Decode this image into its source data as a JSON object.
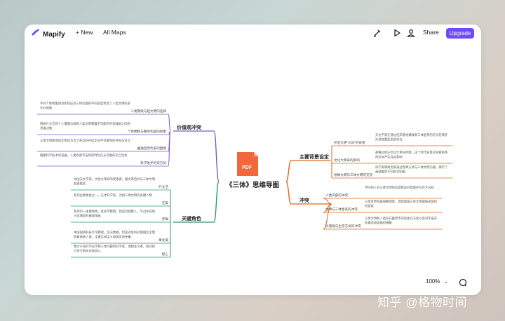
{
  "app": {
    "name": "Mapify",
    "new_label": "New",
    "all_maps_label": "All Maps",
    "share_label": "Share",
    "upgrade_label": "Upgrade",
    "zoom": "100%",
    "watermark": "知乎 @格物时间"
  },
  "icons": {
    "logo": "mapify-logo-icon",
    "plus": "plus-icon",
    "brush": "brush-icon",
    "play": "play-icon",
    "user": "user-icon",
    "zoom_dropdown": "chevron-down-icon",
    "chat": "chat-icon",
    "pdf": "pdf-file-icon"
  },
  "colors": {
    "accent": "#6d4aff",
    "branch_values": "#7a5ac8",
    "branch_characters": "#2e9a64",
    "branch_themes": "#e0661f",
    "branch_conflict": "#e0661f",
    "pdf": "#f2683d"
  },
  "mindmap": {
    "root": "《三体》思维导图",
    "pdf_label": "PDF",
    "values": {
      "label": "价值观冲突",
      "items": [
        {
          "label": "人类救赎与超文明的选择",
          "note": "不同个体和集团对如何应对三体问题的不同态度体现了人类文明的多元价值观"
        },
        {
          "label": "个体牺牲与整体利益的权衡",
          "note": "例如叶文洁的个人遭遇与她将人类文明暴露于可能的外星威胁之间的矛盾决策"
        },
        {
          "label": "幽独自然代表的困境",
          "note": "三体文明和地球文明双方为了各自的存续走向不可避免的冲突与对立"
        },
        {
          "label": "科学进步的双刃剑",
          "note": "随着科学技术的发展，人类探索宇宙的同时也在未可能的灭亡危机"
        }
      ]
    },
    "characters": {
      "label": "关键角色",
      "items": [
        {
          "label": "叶文洁",
          "note": "中国天文学家，文化大革命的受害者。跟文革后并与三体文明取得联系"
        },
        {
          "label": "汪淼",
          "note": "系列主要角色之一，天才科学家，对抗三体文明的关键人物"
        },
        {
          "label": "罗辑",
          "note": "系列另一主要角色，社会学教授，后成为面壁人，学过多名和三体博弈的重要角色"
        },
        {
          "label": "章北海",
          "note": "中国国防科技大学教授，坚决勇敢，但是对危机对策相信无需依靠拯救人类，注重实用主义和现实的考量"
        },
        {
          "label": "程心",
          "note": "致力于研究宇宙学和三体问题的科学家，理想主义者，和对抗三体文明无奈和态心"
        }
      ]
    },
    "themes": {
      "label": "主要背景设定",
      "items": [
        {
          "label": "外星文明\"三体\"的背景",
          "note": "天文学家在通过红岸基地偶收到三体星系的信号后揭开外星智慧生命的存在"
        },
        {
          "label": "文化大革命的影响",
          "note": "故事起始于文化大革命时期，这个时代背景对主要角色的命运产生深远影响"
        },
        {
          "label": "地球文明与三体文明的交流",
          "note": "科学家和政治家通过各种方式与三体文明沟通，揭示了两种截然不同的文明观"
        }
      ]
    },
    "conflict": {
      "label": "冲突",
      "items": [
        {
          "label": "人类内部的冲突",
          "note": "不同的人对三体文明的态度和应对措施存在巨大分歧"
        },
        {
          "label": "地球与三体星系的冲突",
          "note": "三体世界准备侵略地球，地球面临三体文明威胁还是抗的现状"
        },
        {
          "label": "价值观与生存方式的冲突",
          "note": "三体文明和人类存在截然不同的生存方式以及对宇宙存在模式和道德的理解"
        }
      ]
    }
  }
}
